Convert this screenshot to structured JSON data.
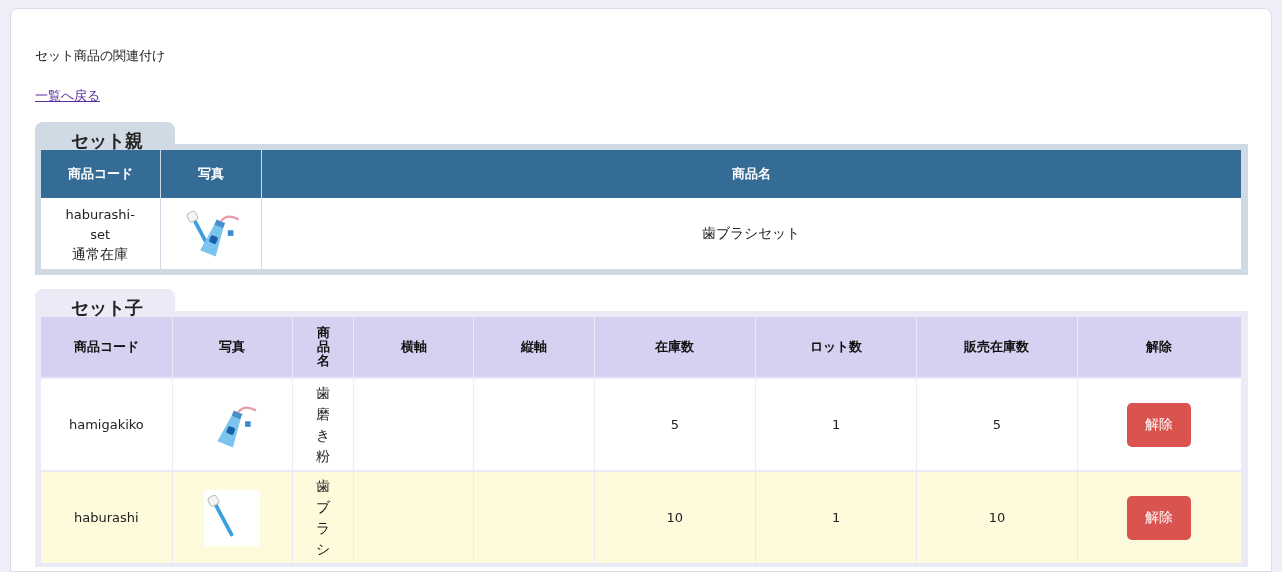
{
  "page": {
    "title": "セット商品の関連付け",
    "back_link": "一覧へ戻る"
  },
  "parent": {
    "heading": "セット親",
    "columns": [
      "商品コード",
      "写真",
      "商品名"
    ],
    "rows": [
      {
        "code": "haburashi-set",
        "stock_type": "通常在庫",
        "name": "歯ブラシセット"
      }
    ]
  },
  "children": {
    "heading": "セット子",
    "columns": [
      "商品コード",
      "写真",
      "商品名",
      "横軸",
      "縦軸",
      "在庫数",
      "ロット数",
      "販売在庫数",
      "解除"
    ],
    "rows": [
      {
        "code": "hamigakiko",
        "name": "歯磨き粉",
        "stock": "5",
        "lot": "1",
        "sales_stock": "5",
        "action": "解除",
        "highlighted": false
      },
      {
        "code": "haburashi",
        "name": "歯ブラシ",
        "stock": "10",
        "lot": "1",
        "sales_stock": "10",
        "action": "解除",
        "highlighted": true
      }
    ]
  }
}
